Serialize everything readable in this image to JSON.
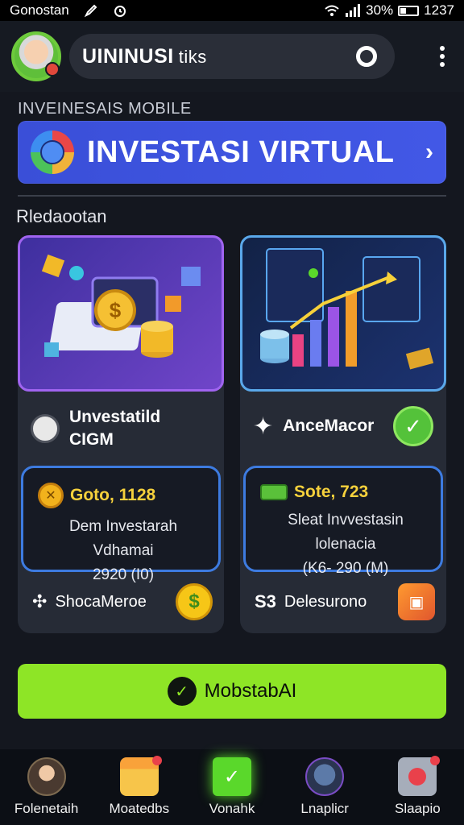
{
  "status_bar": {
    "carrier": "Gonostan",
    "battery": "30%",
    "time": "1237"
  },
  "app_bar": {
    "title": "UININUSI",
    "title_suffix": "tiks"
  },
  "section_label": "INVEINESAIS MOBILE",
  "hero": {
    "title": "INVESTASI VIRTUAL",
    "chevron": "›"
  },
  "subheading": "Rledaootan",
  "cards": [
    {
      "title_line1": "Unvestatild",
      "title_line2": "CIGM",
      "price": "Goto, 1128",
      "desc_line1": "Dem Investarah Vdhamai",
      "desc_line2": "2920 (I0)",
      "foot_symbol": "✣",
      "foot_label": "ShocaMeroe",
      "foot_badge": "$"
    },
    {
      "title_line1": "AnceMacor",
      "title_line2": "",
      "price": "Sote, 723",
      "desc_line1": "Sleat Invvestasin lolenacia",
      "desc_line2": "(K6- 290 (M)",
      "foot_symbol": "S3",
      "foot_label": "Delesurono",
      "foot_badge": "✓"
    }
  ],
  "cta": {
    "label": "MobstabAI"
  },
  "bottom_nav": [
    {
      "label": "Folenetaih",
      "icon": "person-icon"
    },
    {
      "label": "Moatedbs",
      "icon": "calendar-icon"
    },
    {
      "label": "Vonahk",
      "icon": "cube-icon"
    },
    {
      "label": "Lnaplicr",
      "icon": "explore-icon"
    },
    {
      "label": "Slaapio",
      "icon": "profile-icon"
    }
  ],
  "colors": {
    "background": "#14171f",
    "hero": "#4258e6",
    "cta": "#8ee526",
    "price": "#f6d13c"
  }
}
